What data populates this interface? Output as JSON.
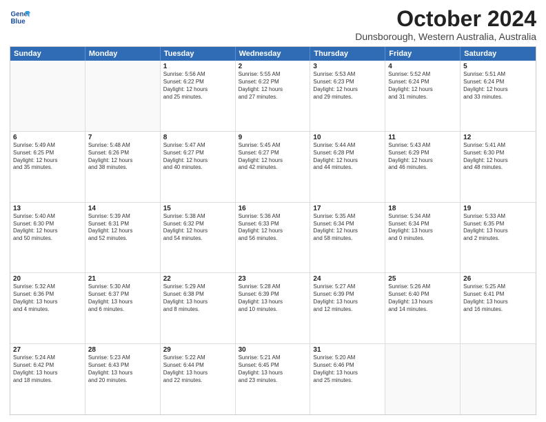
{
  "header": {
    "logo_line1": "General",
    "logo_line2": "Blue",
    "month_title": "October 2024",
    "location": "Dunsborough, Western Australia, Australia"
  },
  "days": [
    "Sunday",
    "Monday",
    "Tuesday",
    "Wednesday",
    "Thursday",
    "Friday",
    "Saturday"
  ],
  "weeks": [
    [
      {
        "day": "",
        "empty": true
      },
      {
        "day": "",
        "empty": true
      },
      {
        "day": "1",
        "sunrise": "5:56 AM",
        "sunset": "6:22 PM",
        "daylight": "12 hours and 25 minutes."
      },
      {
        "day": "2",
        "sunrise": "5:55 AM",
        "sunset": "6:22 PM",
        "daylight": "12 hours and 27 minutes."
      },
      {
        "day": "3",
        "sunrise": "5:53 AM",
        "sunset": "6:23 PM",
        "daylight": "12 hours and 29 minutes."
      },
      {
        "day": "4",
        "sunrise": "5:52 AM",
        "sunset": "6:24 PM",
        "daylight": "12 hours and 31 minutes."
      },
      {
        "day": "5",
        "sunrise": "5:51 AM",
        "sunset": "6:24 PM",
        "daylight": "12 hours and 33 minutes."
      }
    ],
    [
      {
        "day": "6",
        "sunrise": "5:49 AM",
        "sunset": "6:25 PM",
        "daylight": "12 hours and 35 minutes."
      },
      {
        "day": "7",
        "sunrise": "5:48 AM",
        "sunset": "6:26 PM",
        "daylight": "12 hours and 38 minutes."
      },
      {
        "day": "8",
        "sunrise": "5:47 AM",
        "sunset": "6:27 PM",
        "daylight": "12 hours and 40 minutes."
      },
      {
        "day": "9",
        "sunrise": "5:45 AM",
        "sunset": "6:27 PM",
        "daylight": "12 hours and 42 minutes."
      },
      {
        "day": "10",
        "sunrise": "5:44 AM",
        "sunset": "6:28 PM",
        "daylight": "12 hours and 44 minutes."
      },
      {
        "day": "11",
        "sunrise": "5:43 AM",
        "sunset": "6:29 PM",
        "daylight": "12 hours and 46 minutes."
      },
      {
        "day": "12",
        "sunrise": "5:41 AM",
        "sunset": "6:30 PM",
        "daylight": "12 hours and 48 minutes."
      }
    ],
    [
      {
        "day": "13",
        "sunrise": "5:40 AM",
        "sunset": "6:30 PM",
        "daylight": "12 hours and 50 minutes."
      },
      {
        "day": "14",
        "sunrise": "5:39 AM",
        "sunset": "6:31 PM",
        "daylight": "12 hours and 52 minutes."
      },
      {
        "day": "15",
        "sunrise": "5:38 AM",
        "sunset": "6:32 PM",
        "daylight": "12 hours and 54 minutes."
      },
      {
        "day": "16",
        "sunrise": "5:36 AM",
        "sunset": "6:33 PM",
        "daylight": "12 hours and 56 minutes."
      },
      {
        "day": "17",
        "sunrise": "5:35 AM",
        "sunset": "6:34 PM",
        "daylight": "12 hours and 58 minutes."
      },
      {
        "day": "18",
        "sunrise": "5:34 AM",
        "sunset": "6:34 PM",
        "daylight": "13 hours and 0 minutes."
      },
      {
        "day": "19",
        "sunrise": "5:33 AM",
        "sunset": "6:35 PM",
        "daylight": "13 hours and 2 minutes."
      }
    ],
    [
      {
        "day": "20",
        "sunrise": "5:32 AM",
        "sunset": "6:36 PM",
        "daylight": "13 hours and 4 minutes."
      },
      {
        "day": "21",
        "sunrise": "5:30 AM",
        "sunset": "6:37 PM",
        "daylight": "13 hours and 6 minutes."
      },
      {
        "day": "22",
        "sunrise": "5:29 AM",
        "sunset": "6:38 PM",
        "daylight": "13 hours and 8 minutes."
      },
      {
        "day": "23",
        "sunrise": "5:28 AM",
        "sunset": "6:39 PM",
        "daylight": "13 hours and 10 minutes."
      },
      {
        "day": "24",
        "sunrise": "5:27 AM",
        "sunset": "6:39 PM",
        "daylight": "13 hours and 12 minutes."
      },
      {
        "day": "25",
        "sunrise": "5:26 AM",
        "sunset": "6:40 PM",
        "daylight": "13 hours and 14 minutes."
      },
      {
        "day": "26",
        "sunrise": "5:25 AM",
        "sunset": "6:41 PM",
        "daylight": "13 hours and 16 minutes."
      }
    ],
    [
      {
        "day": "27",
        "sunrise": "5:24 AM",
        "sunset": "6:42 PM",
        "daylight": "13 hours and 18 minutes."
      },
      {
        "day": "28",
        "sunrise": "5:23 AM",
        "sunset": "6:43 PM",
        "daylight": "13 hours and 20 minutes."
      },
      {
        "day": "29",
        "sunrise": "5:22 AM",
        "sunset": "6:44 PM",
        "daylight": "13 hours and 22 minutes."
      },
      {
        "day": "30",
        "sunrise": "5:21 AM",
        "sunset": "6:45 PM",
        "daylight": "13 hours and 23 minutes."
      },
      {
        "day": "31",
        "sunrise": "5:20 AM",
        "sunset": "6:46 PM",
        "daylight": "13 hours and 25 minutes."
      },
      {
        "day": "",
        "empty": true
      },
      {
        "day": "",
        "empty": true
      }
    ]
  ]
}
